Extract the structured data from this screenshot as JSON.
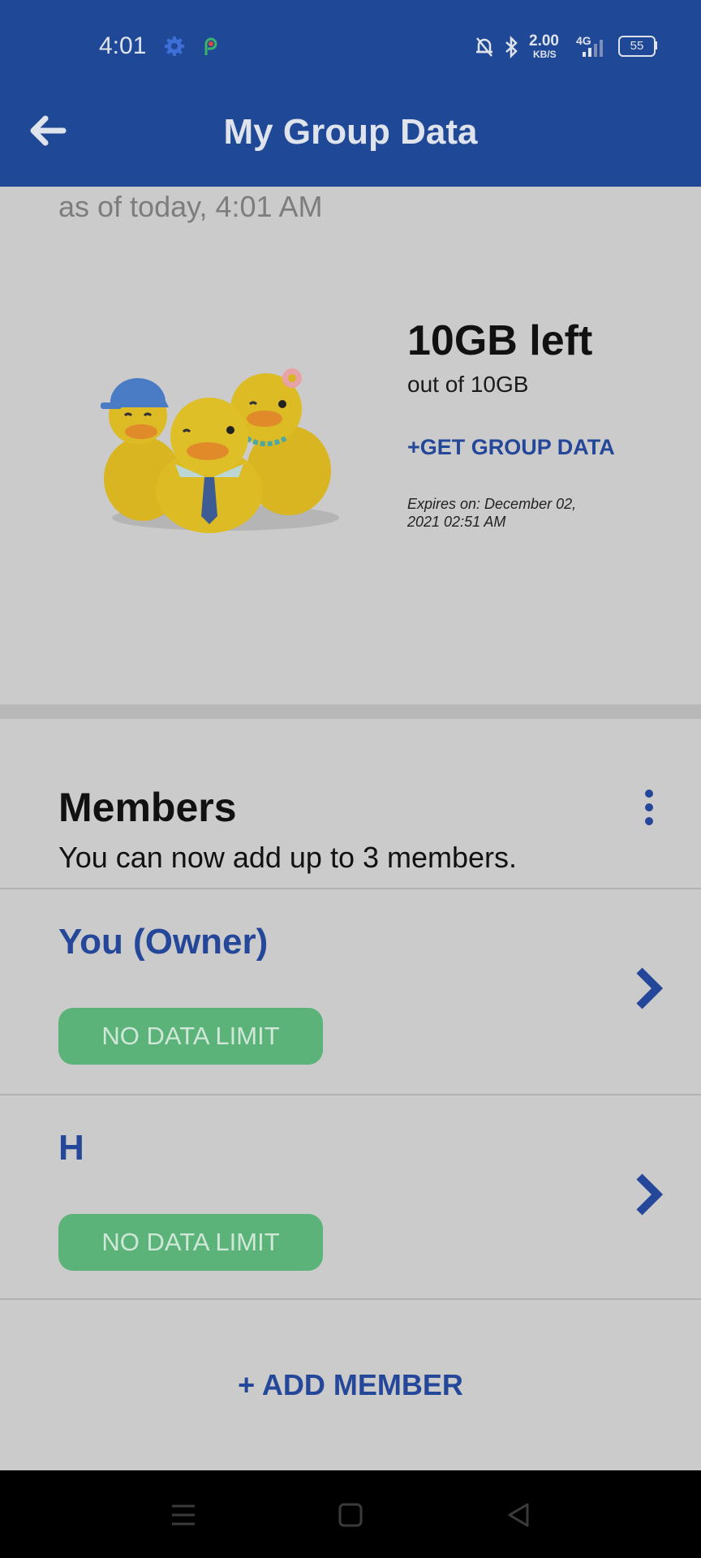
{
  "status_bar": {
    "time": "4:01",
    "speed_value": "2.00",
    "speed_unit": "KB/S",
    "network": "4G",
    "battery": "55",
    "icons": [
      "settings-icon",
      "assistant-icon",
      "mute-bell-icon",
      "bluetooth-icon",
      "signal-icon",
      "battery-icon"
    ]
  },
  "app_bar": {
    "title": "My Group Data",
    "back_icon": "arrow-left-icon"
  },
  "summary": {
    "as_of": "as of today, 4:01 AM",
    "data_left": "10GB left",
    "out_of": "out of 10GB",
    "get_data": "+GET GROUP DATA",
    "expires": "Expires on: December 02, 2021 02:51 AM"
  },
  "members": {
    "title": "Members",
    "subtitle": "You can now add up to 3 members.",
    "list": [
      {
        "name": "You (Owner)",
        "badge": "NO DATA LIMIT"
      },
      {
        "name": "H",
        "badge": "NO DATA LIMIT"
      }
    ],
    "add_label": "+ ADD MEMBER"
  },
  "colors": {
    "app_bar": "#1f4996",
    "accent": "#25479a",
    "badge": "#5cb37a",
    "background": "#cbcbcb"
  }
}
